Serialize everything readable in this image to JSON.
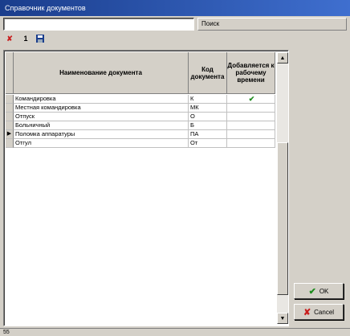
{
  "window": {
    "title": "Справочник документов"
  },
  "search": {
    "value": "",
    "label": "Поиск"
  },
  "toolbar": {
    "refresh_label": "1"
  },
  "grid": {
    "headers": {
      "name": "Наименование документа",
      "code": "Код документа",
      "flag": "Добавляется к рабочему времени"
    },
    "current_row_marker": "▶",
    "rows": [
      {
        "name": "Командировка",
        "code": "К",
        "flag": "✔"
      },
      {
        "name": "Местная командировка",
        "code": "МК",
        "flag": ""
      },
      {
        "name": "Отпуск",
        "code": "О",
        "flag": ""
      },
      {
        "name": "Больничный",
        "code": "Б",
        "flag": ""
      },
      {
        "name": "Поломка аппаратуры",
        "code": "ПА",
        "flag": ""
      },
      {
        "name": "Отгул",
        "code": "От",
        "flag": ""
      }
    ]
  },
  "buttons": {
    "ok": "OK",
    "cancel": "Cancel"
  },
  "status": {
    "text": "55"
  },
  "colors": {
    "title_start": "#1a3d8c",
    "title_end": "#3f6fcf",
    "check": "#1e8c1e",
    "cancel_x": "#c81e1e"
  }
}
